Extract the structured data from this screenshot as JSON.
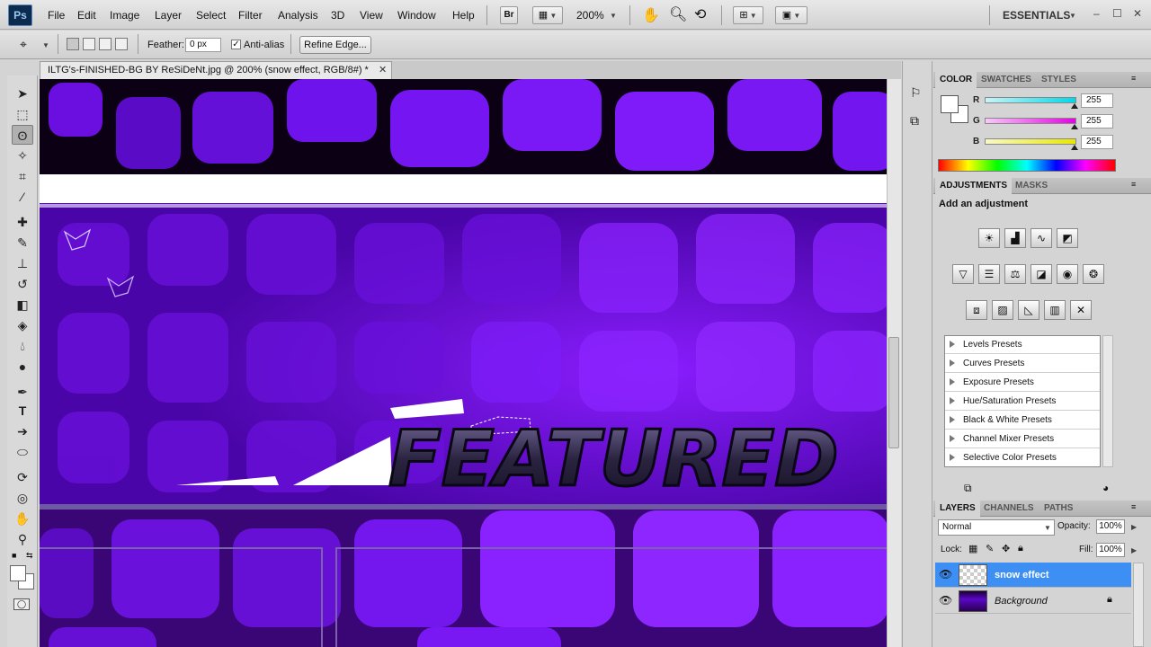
{
  "app": {
    "logo": "Ps",
    "workspace": "ESSENTIALS"
  },
  "menu": [
    "File",
    "Edit",
    "Image",
    "Layer",
    "Select",
    "Filter",
    "Analysis",
    "3D",
    "View",
    "Window",
    "Help"
  ],
  "menubar": {
    "bridge_label": "Br",
    "zoom": "200%",
    "min": "–",
    "max": "☐",
    "close": "✕"
  },
  "options": {
    "feather_label": "Feather:",
    "feather_value": "0 px",
    "antialias_label": "Anti-alias",
    "antialias_checked": "✓",
    "refine_edge": "Refine Edge..."
  },
  "document": {
    "tab_title": "ILTG's-FINISHED-BG BY ReSiDeNt.jpg @ 200% (snow effect, RGB/8#) *",
    "tab_close": "✕",
    "canvas_text": "FEATURED"
  },
  "color_panel": {
    "tabs": [
      "COLOR",
      "SWATCHES",
      "STYLES"
    ],
    "channels": [
      {
        "name": "R",
        "value": "255",
        "color": "#00d8e8"
      },
      {
        "name": "G",
        "value": "255",
        "color": "#e600e6"
      },
      {
        "name": "B",
        "value": "255",
        "color": "#e8e800"
      }
    ]
  },
  "adjustments_panel": {
    "tabs": [
      "ADJUSTMENTS",
      "MASKS"
    ],
    "heading": "Add an adjustment",
    "presets": [
      "Levels Presets",
      "Curves Presets",
      "Exposure Presets",
      "Hue/Saturation Presets",
      "Black & White Presets",
      "Channel Mixer Presets",
      "Selective Color Presets"
    ]
  },
  "layers_panel": {
    "tabs": [
      "LAYERS",
      "CHANNELS",
      "PATHS"
    ],
    "blend_mode": "Normal",
    "opacity_label": "Opacity:",
    "opacity_value": "100%",
    "lock_label": "Lock:",
    "fill_label": "Fill:",
    "fill_value": "100%",
    "layers": [
      {
        "name": "snow effect",
        "selected": true
      },
      {
        "name": "Background",
        "locked": true
      }
    ]
  },
  "colors": {
    "selection_blue": "#3d8ff4",
    "canvas_purple": "#5a07c8"
  }
}
